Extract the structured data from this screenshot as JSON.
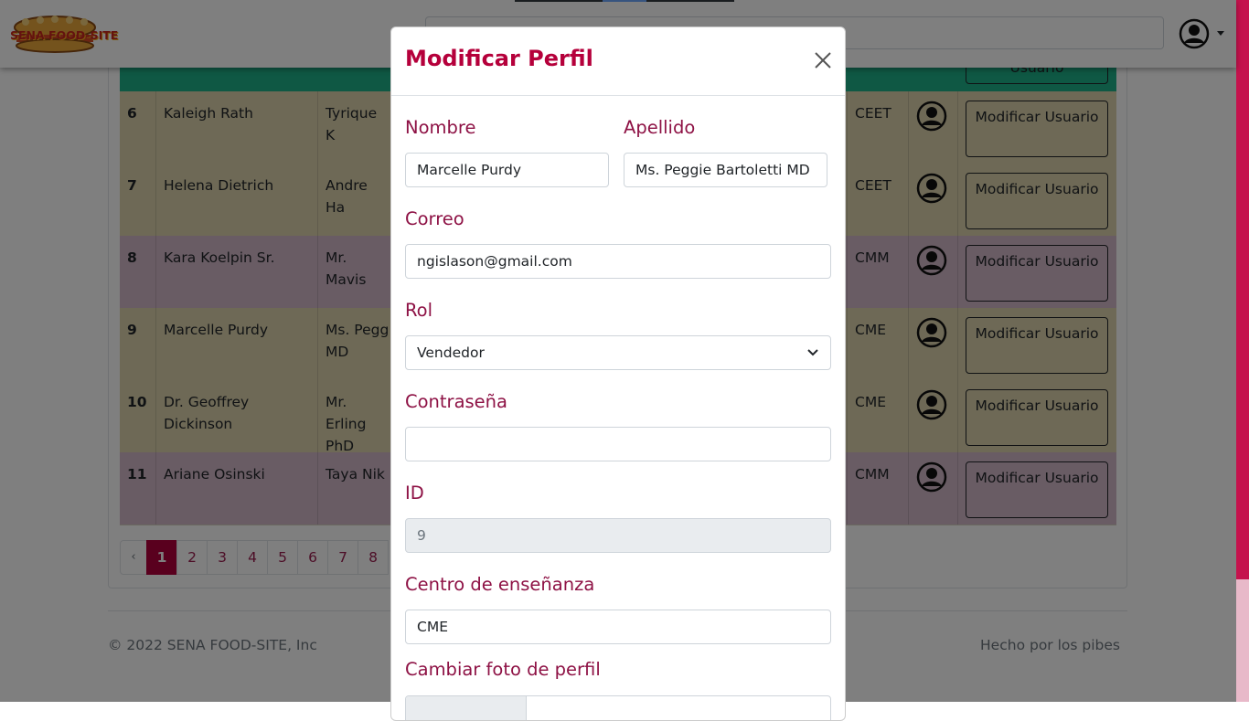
{
  "brand": {
    "logo_text": "SENA FOOD-SITE"
  },
  "header": {
    "search_placeholder": ""
  },
  "table": {
    "partial_button_label": "Usuario",
    "row_button_label": "Modificar Usuario",
    "rows": [
      {
        "id": "6",
        "name": "Kaleigh Rath",
        "surname": "Tyrique K",
        "center": "CEET",
        "color": "#dcd3ad"
      },
      {
        "id": "7",
        "name": "Helena Dietrich",
        "surname": "Andre Ha",
        "center": "CEET",
        "color": "#dcd3ad"
      },
      {
        "id": "8",
        "name": "Kara Koelpin Sr.",
        "surname": "Mr. Mavis",
        "center": "CMM",
        "color": "#d3b9c9"
      },
      {
        "id": "9",
        "name": "Marcelle Purdy",
        "surname": "Ms. Pegg\nMD",
        "center": "CME",
        "color": "#dcd3ad"
      },
      {
        "id": "10",
        "name": "Dr. Geoffrey\nDickinson",
        "surname": "Mr. Erling\nPhD",
        "center": "CME",
        "color": "#dcd3ad"
      },
      {
        "id": "11",
        "name": "Ariane Osinski",
        "surname": "Taya Nik",
        "center": "CMM",
        "color": "#d3b9c9"
      }
    ]
  },
  "pagination": {
    "prev": "‹",
    "pages": [
      "1",
      "2",
      "3",
      "4",
      "5",
      "6",
      "7",
      "8"
    ],
    "active": "1"
  },
  "footer": {
    "left": "© 2022 SENA FOOD-SITE, Inc",
    "right": "Hecho por los pibes"
  },
  "modal": {
    "title": "Modificar Perfil",
    "fields": {
      "nombre_label": "Nombre",
      "nombre_value": "Marcelle Purdy",
      "apellido_label": "Apellido",
      "apellido_value": "Ms. Peggie Bartoletti MD",
      "correo_label": "Correo",
      "correo_value": "ngislason@gmail.com",
      "rol_label": "Rol",
      "rol_value": "Vendedor",
      "password_label": "Contraseña",
      "password_value": "",
      "id_label": "ID",
      "id_value": "9",
      "centro_label": "Centro de enseñanza",
      "centro_value": "CME",
      "foto_label": "Cambiar foto de perfil"
    }
  },
  "colors": {
    "accent": "#b5003b",
    "label": "#8e1245",
    "header_strip": "#1eb088"
  }
}
